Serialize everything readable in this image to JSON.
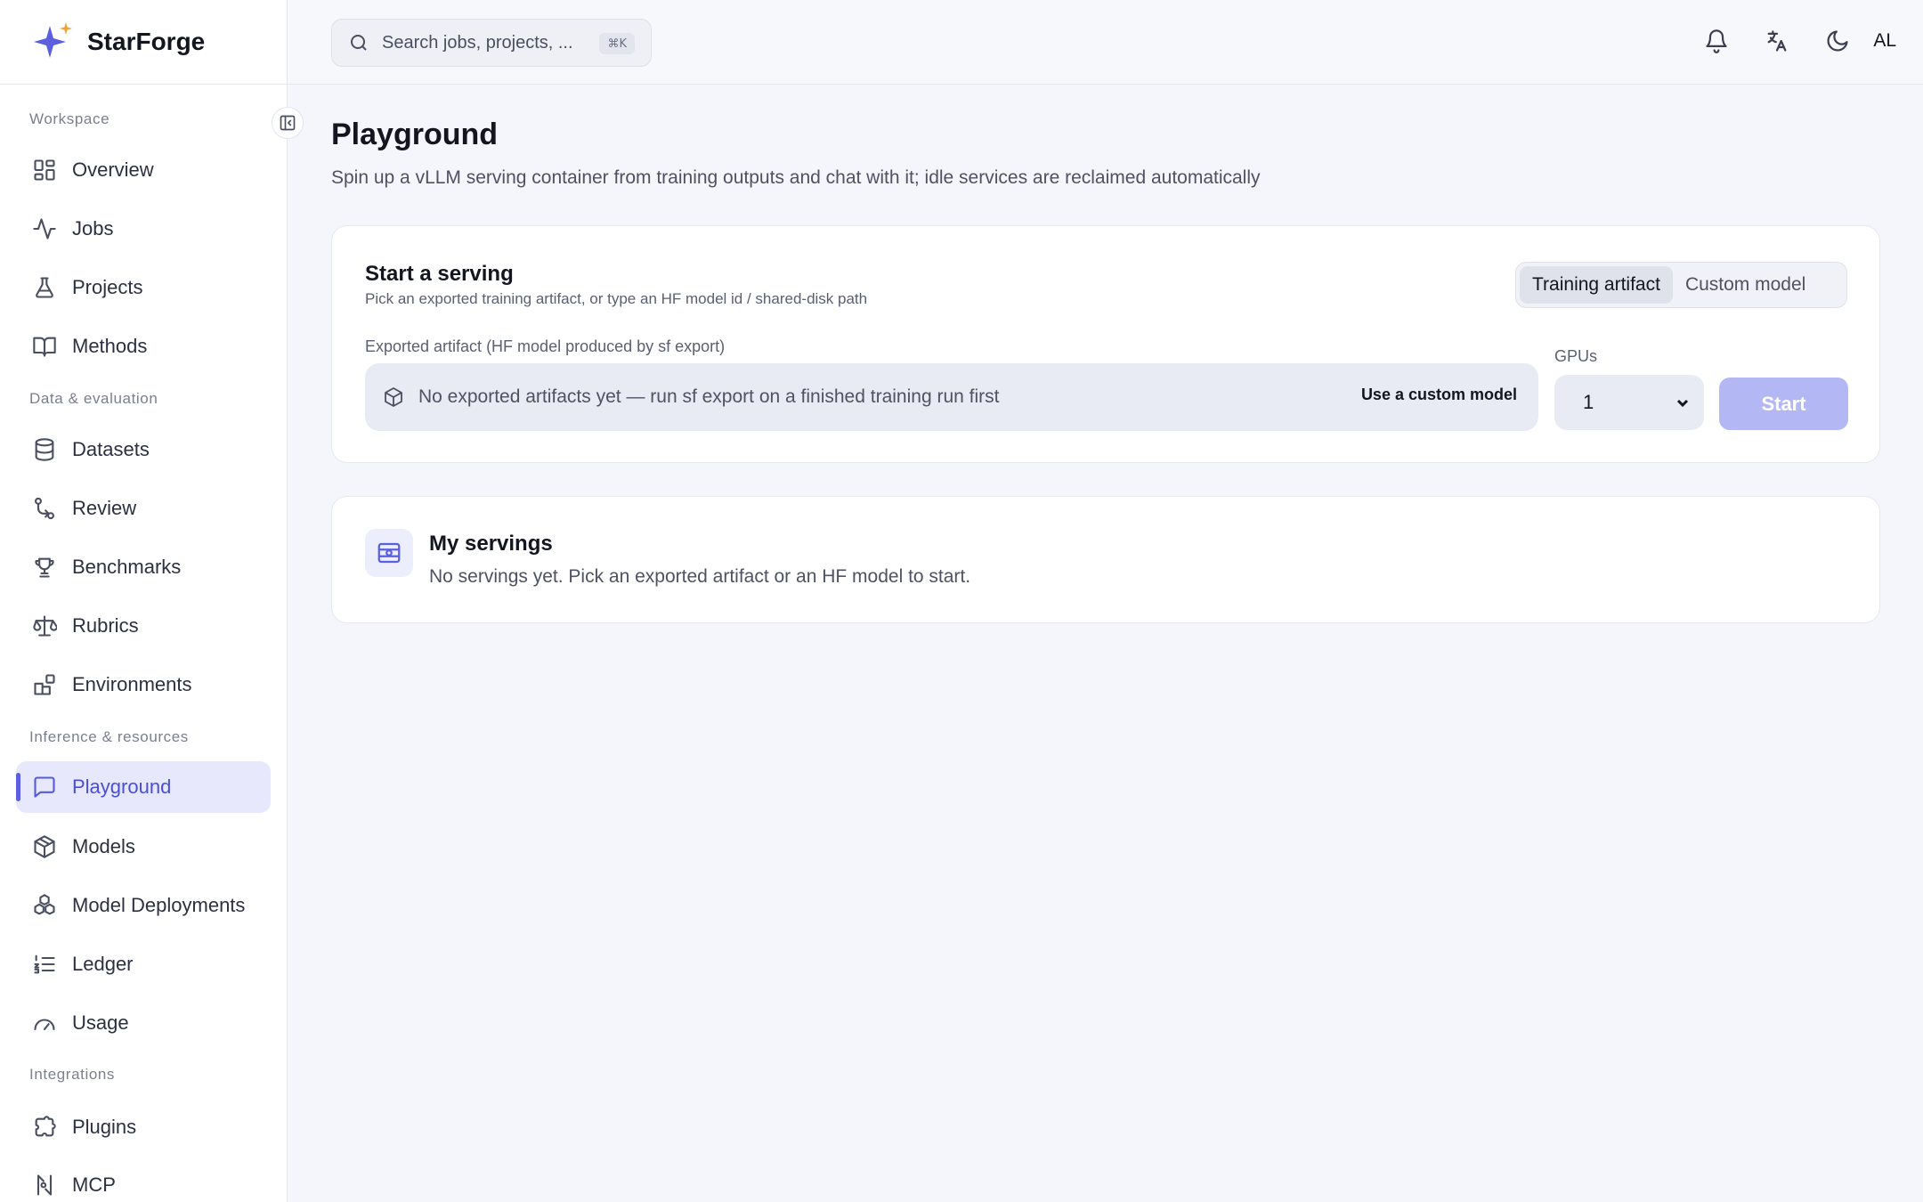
{
  "brand": {
    "name": "StarForge"
  },
  "search": {
    "placeholder": "Search jobs, projects, ...",
    "shortcut": "⌘K"
  },
  "header": {
    "avatar_initials": "AL"
  },
  "sidebar": {
    "sections": [
      {
        "label": "Workspace"
      },
      {
        "label": "Data & evaluation"
      },
      {
        "label": "Inference & resources"
      },
      {
        "label": "Integrations"
      }
    ],
    "items": [
      {
        "label": "Overview",
        "icon": "grid-icon"
      },
      {
        "label": "Jobs",
        "icon": "activity-icon"
      },
      {
        "label": "Projects",
        "icon": "flask-icon"
      },
      {
        "label": "Methods",
        "icon": "book-icon"
      },
      {
        "label": "Datasets",
        "icon": "database-icon"
      },
      {
        "label": "Review",
        "icon": "git-compare-icon"
      },
      {
        "label": "Benchmarks",
        "icon": "trophy-icon"
      },
      {
        "label": "Rubrics",
        "icon": "scale-icon"
      },
      {
        "label": "Environments",
        "icon": "blocks-icon"
      },
      {
        "label": "Playground",
        "icon": "chat-icon",
        "active": true
      },
      {
        "label": "Models",
        "icon": "cube-icon"
      },
      {
        "label": "Model Deployments",
        "icon": "boxes-icon"
      },
      {
        "label": "Ledger",
        "icon": "list-ordered-icon"
      },
      {
        "label": "Usage",
        "icon": "gauge-icon"
      },
      {
        "label": "Plugins",
        "icon": "puzzle-icon"
      },
      {
        "label": "MCP",
        "icon": "mcp-icon"
      }
    ]
  },
  "page": {
    "title": "Playground",
    "subtitle": "Spin up a vLLM serving container from training outputs and chat with it; idle services are reclaimed automatically"
  },
  "start_serving": {
    "title": "Start a serving",
    "description": "Pick an exported training artifact, or type an HF model id / shared-disk path",
    "tabs": [
      {
        "label": "Training artifact",
        "selected": true
      },
      {
        "label": "Custom model",
        "selected": false
      }
    ],
    "artifact_label": "Exported artifact (HF model produced by sf export)",
    "artifact_empty": "No exported artifacts yet — run sf export on a finished training run first",
    "custom_model_link": "Use a custom model",
    "gpus_label": "GPUs",
    "gpus_value": "1",
    "start_label": "Start"
  },
  "my_servings": {
    "title": "My servings",
    "empty": "No servings yet. Pick an exported artifact or an HF model to start."
  },
  "colors": {
    "accent": "#5b5fe0",
    "start_disabled": "#b3b8f4",
    "active_bg": "#e7e8fb"
  }
}
